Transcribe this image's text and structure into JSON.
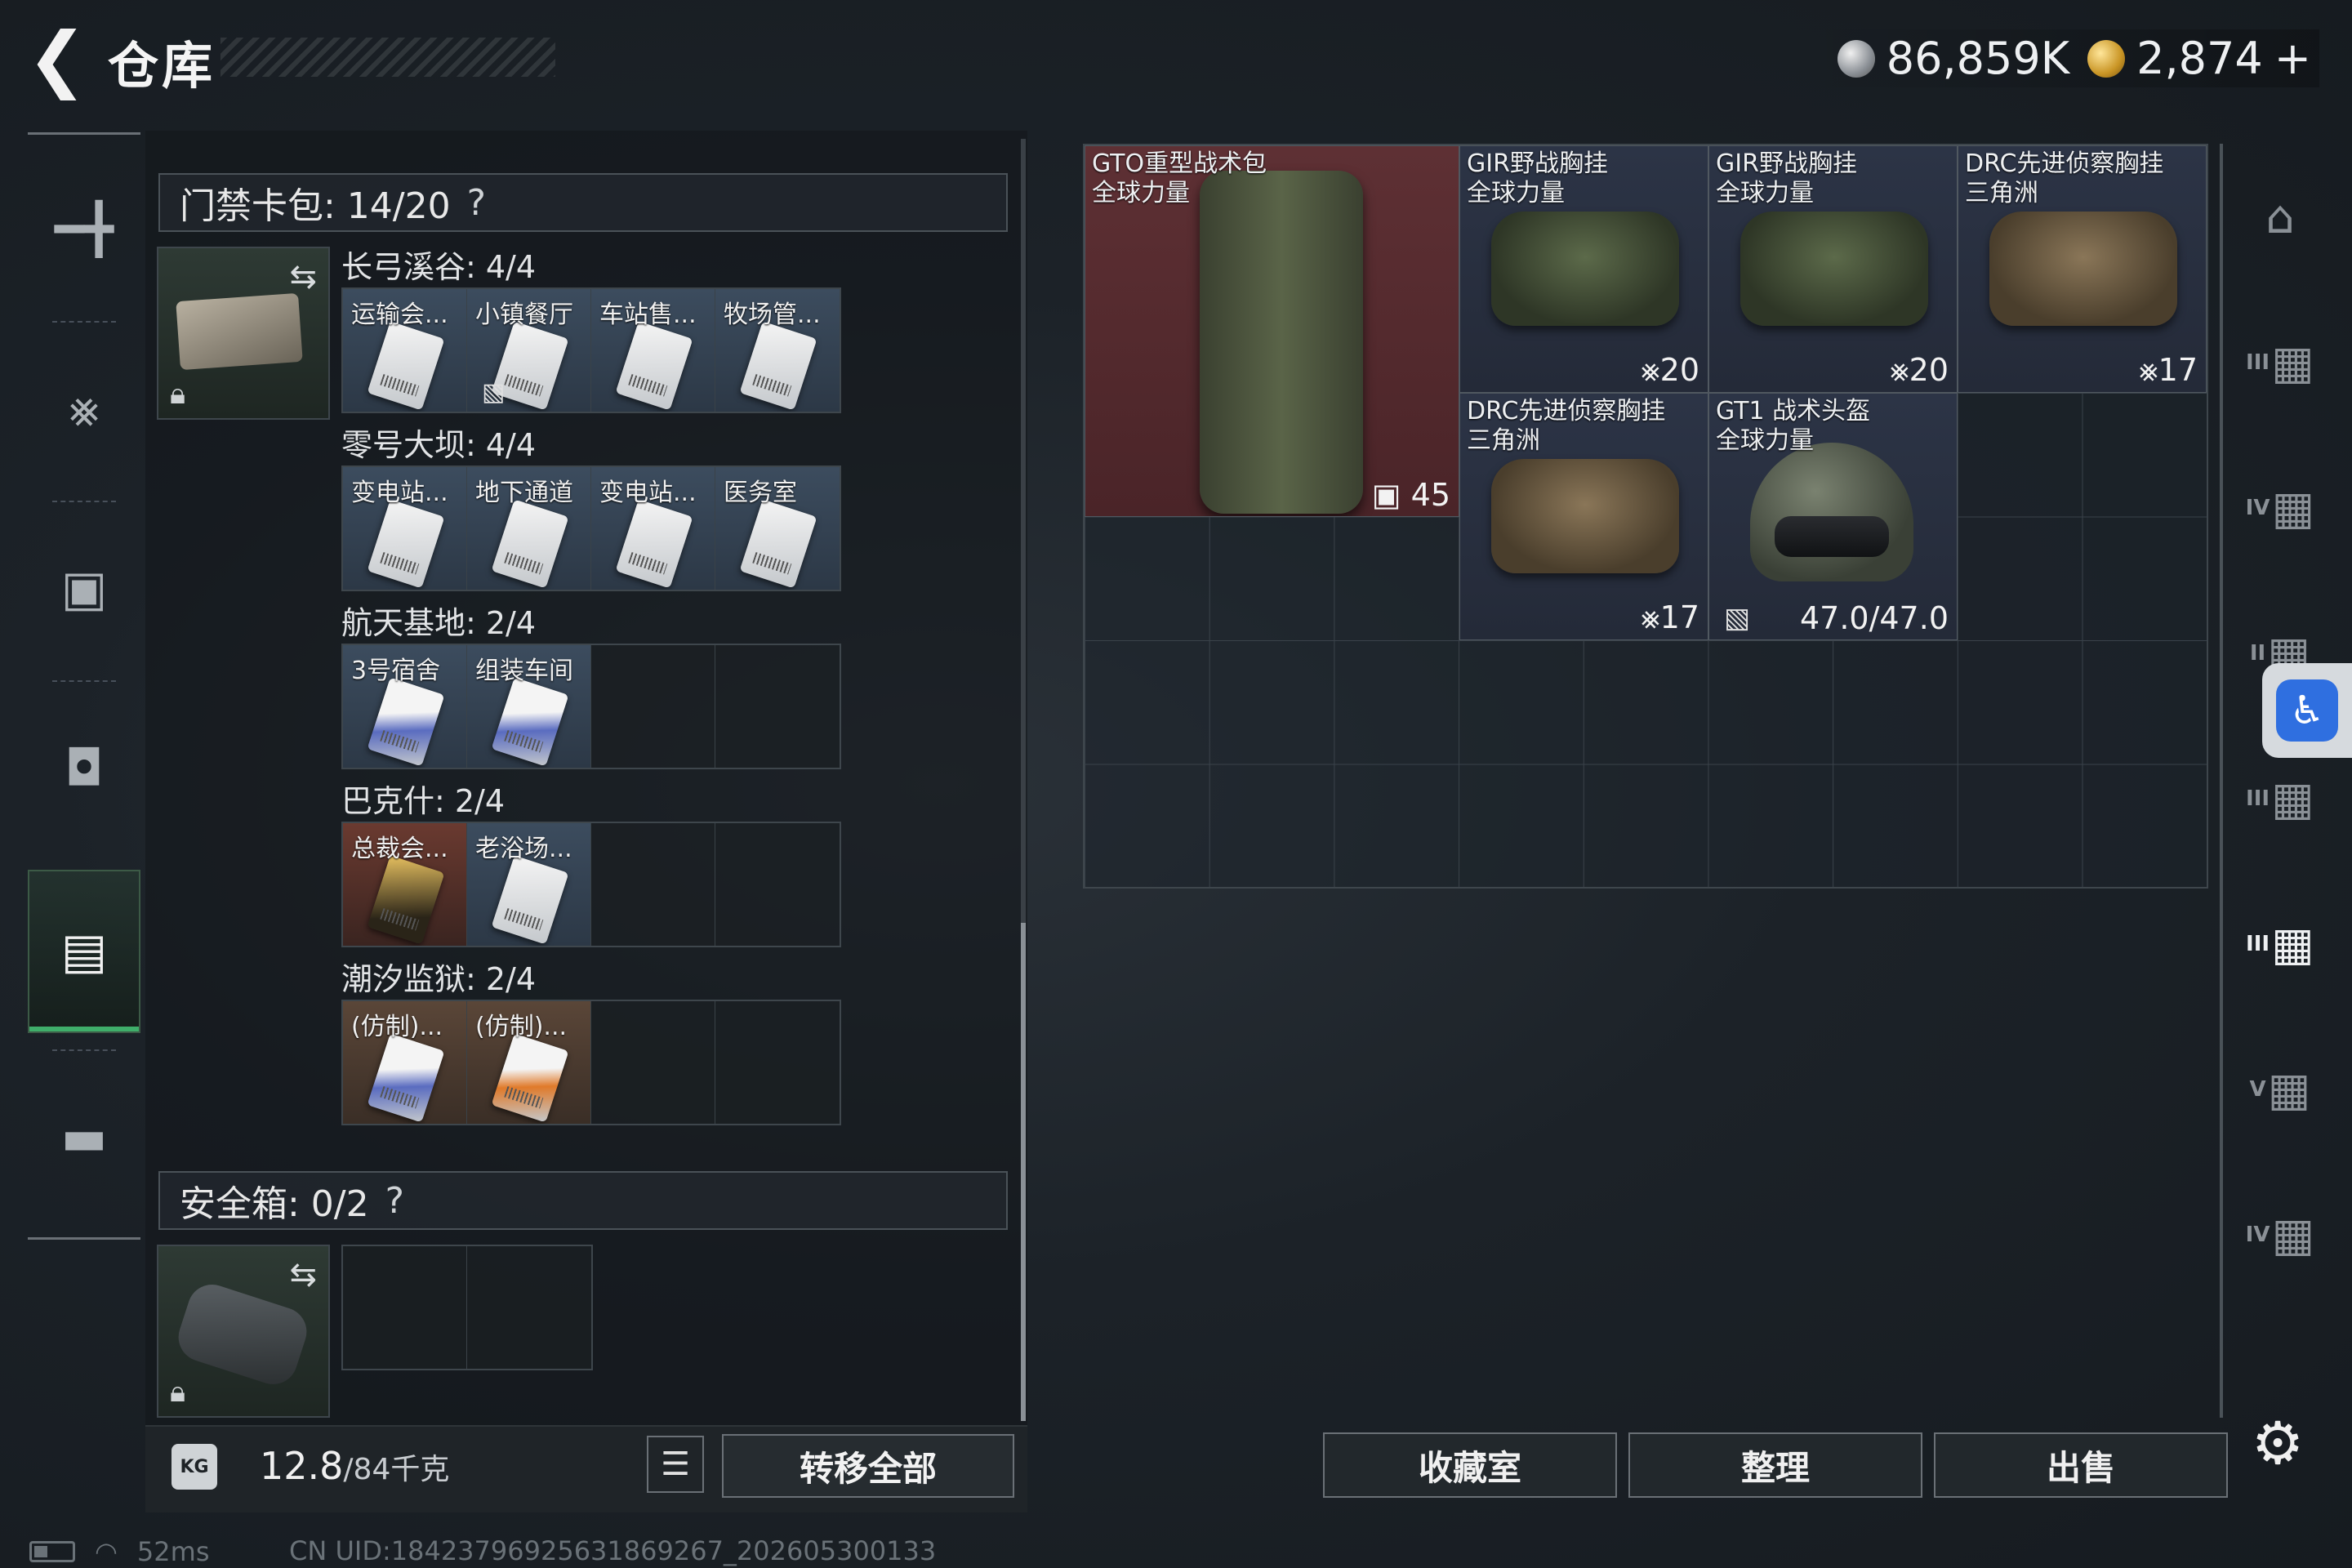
{
  "header": {
    "title": "仓库",
    "currency": [
      {
        "icon": "silver-coin-icon",
        "amount": "86,859K"
      },
      {
        "icon": "gold-coin-icon",
        "amount": "2,874"
      }
    ],
    "add_label": "+"
  },
  "left_nav": {
    "items": [
      {
        "icon": "gun-icon",
        "active": false
      },
      {
        "icon": "vest-icon",
        "active": false
      },
      {
        "icon": "backpack-icon",
        "active": false
      },
      {
        "icon": "helmet-bag-icon",
        "active": false
      },
      {
        "icon": "card-pack-icon",
        "active": true
      },
      {
        "icon": "briefcase-icon",
        "active": false
      }
    ]
  },
  "keycard_pack": {
    "title": "门禁卡包: 14/20",
    "help": "?",
    "maps": [
      {
        "label": "长弓溪谷: 4/4",
        "cards": [
          {
            "name": "运输会...",
            "style": "filled",
            "tint": ""
          },
          {
            "name": "小镇餐厅",
            "style": "filled",
            "tint": "",
            "no_insure": true
          },
          {
            "name": "车站售...",
            "style": "filled",
            "tint": ""
          },
          {
            "name": "牧场管...",
            "style": "filled",
            "tint": ""
          }
        ]
      },
      {
        "label": "零号大坝: 4/4",
        "cards": [
          {
            "name": "变电站...",
            "style": "filled",
            "tint": ""
          },
          {
            "name": "地下通道",
            "style": "filled",
            "tint": ""
          },
          {
            "name": "变电站...",
            "style": "filled",
            "tint": ""
          },
          {
            "name": "医务室",
            "style": "filled",
            "tint": ""
          }
        ]
      },
      {
        "label": "航天基地: 2/4",
        "cards": [
          {
            "name": "3号宿舍",
            "style": "filled",
            "tint": "blue"
          },
          {
            "name": "组装车间",
            "style": "filled",
            "tint": "blue"
          },
          {
            "name": "",
            "style": "empty",
            "tint": ""
          },
          {
            "name": "",
            "style": "empty",
            "tint": ""
          }
        ]
      },
      {
        "label": "巴克什: 2/4",
        "cards": [
          {
            "name": "总裁会...",
            "style": "gold",
            "tint": "goldc"
          },
          {
            "name": "老浴场...",
            "style": "filled",
            "tint": ""
          },
          {
            "name": "",
            "style": "empty",
            "tint": ""
          },
          {
            "name": "",
            "style": "empty",
            "tint": ""
          }
        ]
      },
      {
        "label": "潮汐监狱: 2/4",
        "cards": [
          {
            "name": "(仿制)...",
            "style": "fake",
            "tint": "blue"
          },
          {
            "name": "(仿制)...",
            "style": "fake",
            "tint": "orange"
          },
          {
            "name": "",
            "style": "empty",
            "tint": ""
          },
          {
            "name": "",
            "style": "empty",
            "tint": ""
          }
        ]
      }
    ]
  },
  "safe_box": {
    "title": "安全箱: 0/2",
    "help": "?"
  },
  "weight": {
    "icon": "KG",
    "current": "12.8",
    "capacity": "/84千克"
  },
  "buttons": {
    "transfer_all": "转移全部",
    "collection": "收藏室",
    "organize": "整理",
    "sell": "出售"
  },
  "storage_items": [
    {
      "name": "GTO重型战术包\n全球力量",
      "count_icon": "bag-capacity-icon",
      "count": "45",
      "kind": "backpack"
    },
    {
      "name": "GIR野战胸挂\n全球力量",
      "count_icon": "vest-capacity-icon",
      "count": "20",
      "kind": "bag"
    },
    {
      "name": "GIR野战胸挂\n全球力量",
      "count_icon": "vest-capacity-icon",
      "count": "20",
      "kind": "bag"
    },
    {
      "name": "DRC先进侦察胸挂\n三角洲",
      "count_icon": "vest-capacity-icon",
      "count": "17",
      "kind": "bag-tan"
    },
    {
      "name": "DRC先进侦察胸挂\n三角洲",
      "count_icon": "vest-capacity-icon",
      "count": "17",
      "kind": "bag-tan"
    },
    {
      "name": "GT1 战术头盔\n全球力量",
      "durability": "47.0/47.0",
      "no_insure": true,
      "kind": "helmet"
    }
  ],
  "right_tabs": [
    {
      "icon": "storage-main-icon",
      "level": ""
    },
    {
      "icon": "storage-ext-icon",
      "level": "III"
    },
    {
      "icon": "storage-ext-icon",
      "level": "IV"
    },
    {
      "icon": "storage-ext-icon",
      "level": "II"
    },
    {
      "icon": "storage-ext-icon",
      "level": "III"
    },
    {
      "icon": "storage-ext-icon",
      "level": "III",
      "active": true
    },
    {
      "icon": "storage-ext-icon",
      "level": "V"
    },
    {
      "icon": "storage-ext-icon",
      "level": "IV"
    }
  ],
  "status_bar": {
    "ping": "52ms",
    "uid": "CN UID:18423796925631869267_202605300133"
  },
  "colors": {
    "accent_green": "#3fae6a",
    "red_item_bg": "#5e3034",
    "accessibility_blue": "#2f6fe0"
  }
}
